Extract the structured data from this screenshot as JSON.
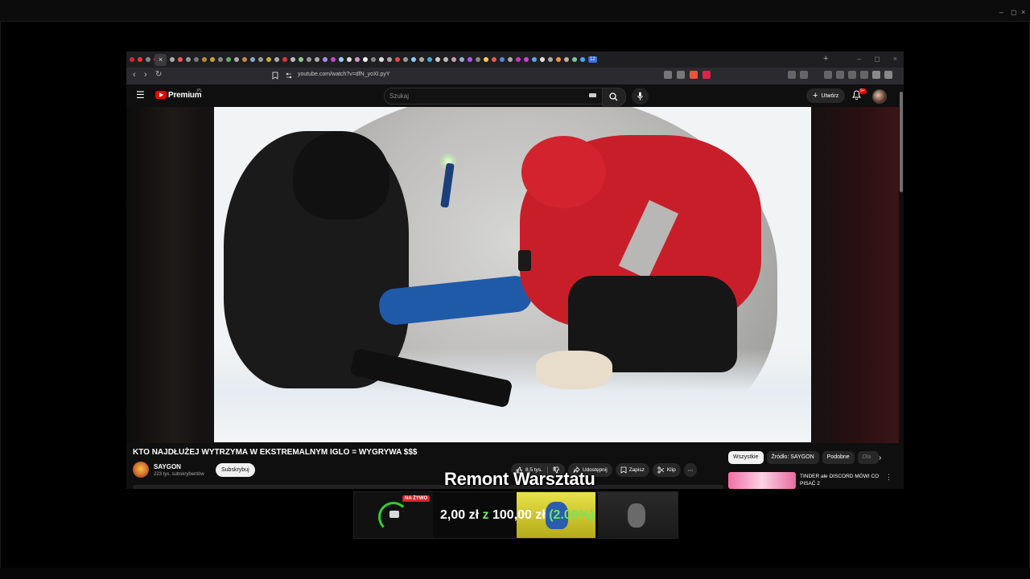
{
  "outer": {
    "controls": [
      "–",
      "◻",
      "×"
    ]
  },
  "browser": {
    "url": "youtube.com/watch?v=dfN_yoXI.pyY",
    "tab_count_badge": "12",
    "new_tab": "+",
    "window_controls": [
      "–",
      "◻",
      "×"
    ]
  },
  "youtube": {
    "logo_text": "Premium",
    "logo_country": "PL",
    "search_placeholder": "Szukaj",
    "create_label": "Utwórz",
    "notif_badge": "9+",
    "video": {
      "title": "KTO NAJDŁUŻEJ WYTRZYMA W EKSTREMALNYM IGLO = WYGRYWA $$$",
      "channel": "SAYGON",
      "subscribers": "223 tys. subskrybentów",
      "subscribe_label": "Subskrybuj",
      "likes": "8,5 tys.",
      "share_label": "Udostępnij",
      "save_label": "Zapisz",
      "clip_label": "Klip",
      "more": "⋯"
    },
    "chips": [
      {
        "label": "Wszystkie",
        "active": true
      },
      {
        "label": "Źródło: SAYGON",
        "active": false
      },
      {
        "label": "Podobne",
        "active": false
      },
      {
        "label": "Dla",
        "active": false
      }
    ],
    "recommendation": {
      "title": "TINDER ale DISCORD MÓWI CO PISAĆ 2"
    }
  },
  "overlay": {
    "title": "Remont Warsztatu",
    "live_badge": "NA ŻYWO",
    "amount": "2,00 zł",
    "connector": "z",
    "goal": "100,00 zł",
    "percent": "(2.00%)",
    "progress_fraction": 0.02
  },
  "colors": {
    "accent_green": "#6ee75e",
    "yt_red": "#ff0000",
    "live_red": "#e0202a"
  }
}
